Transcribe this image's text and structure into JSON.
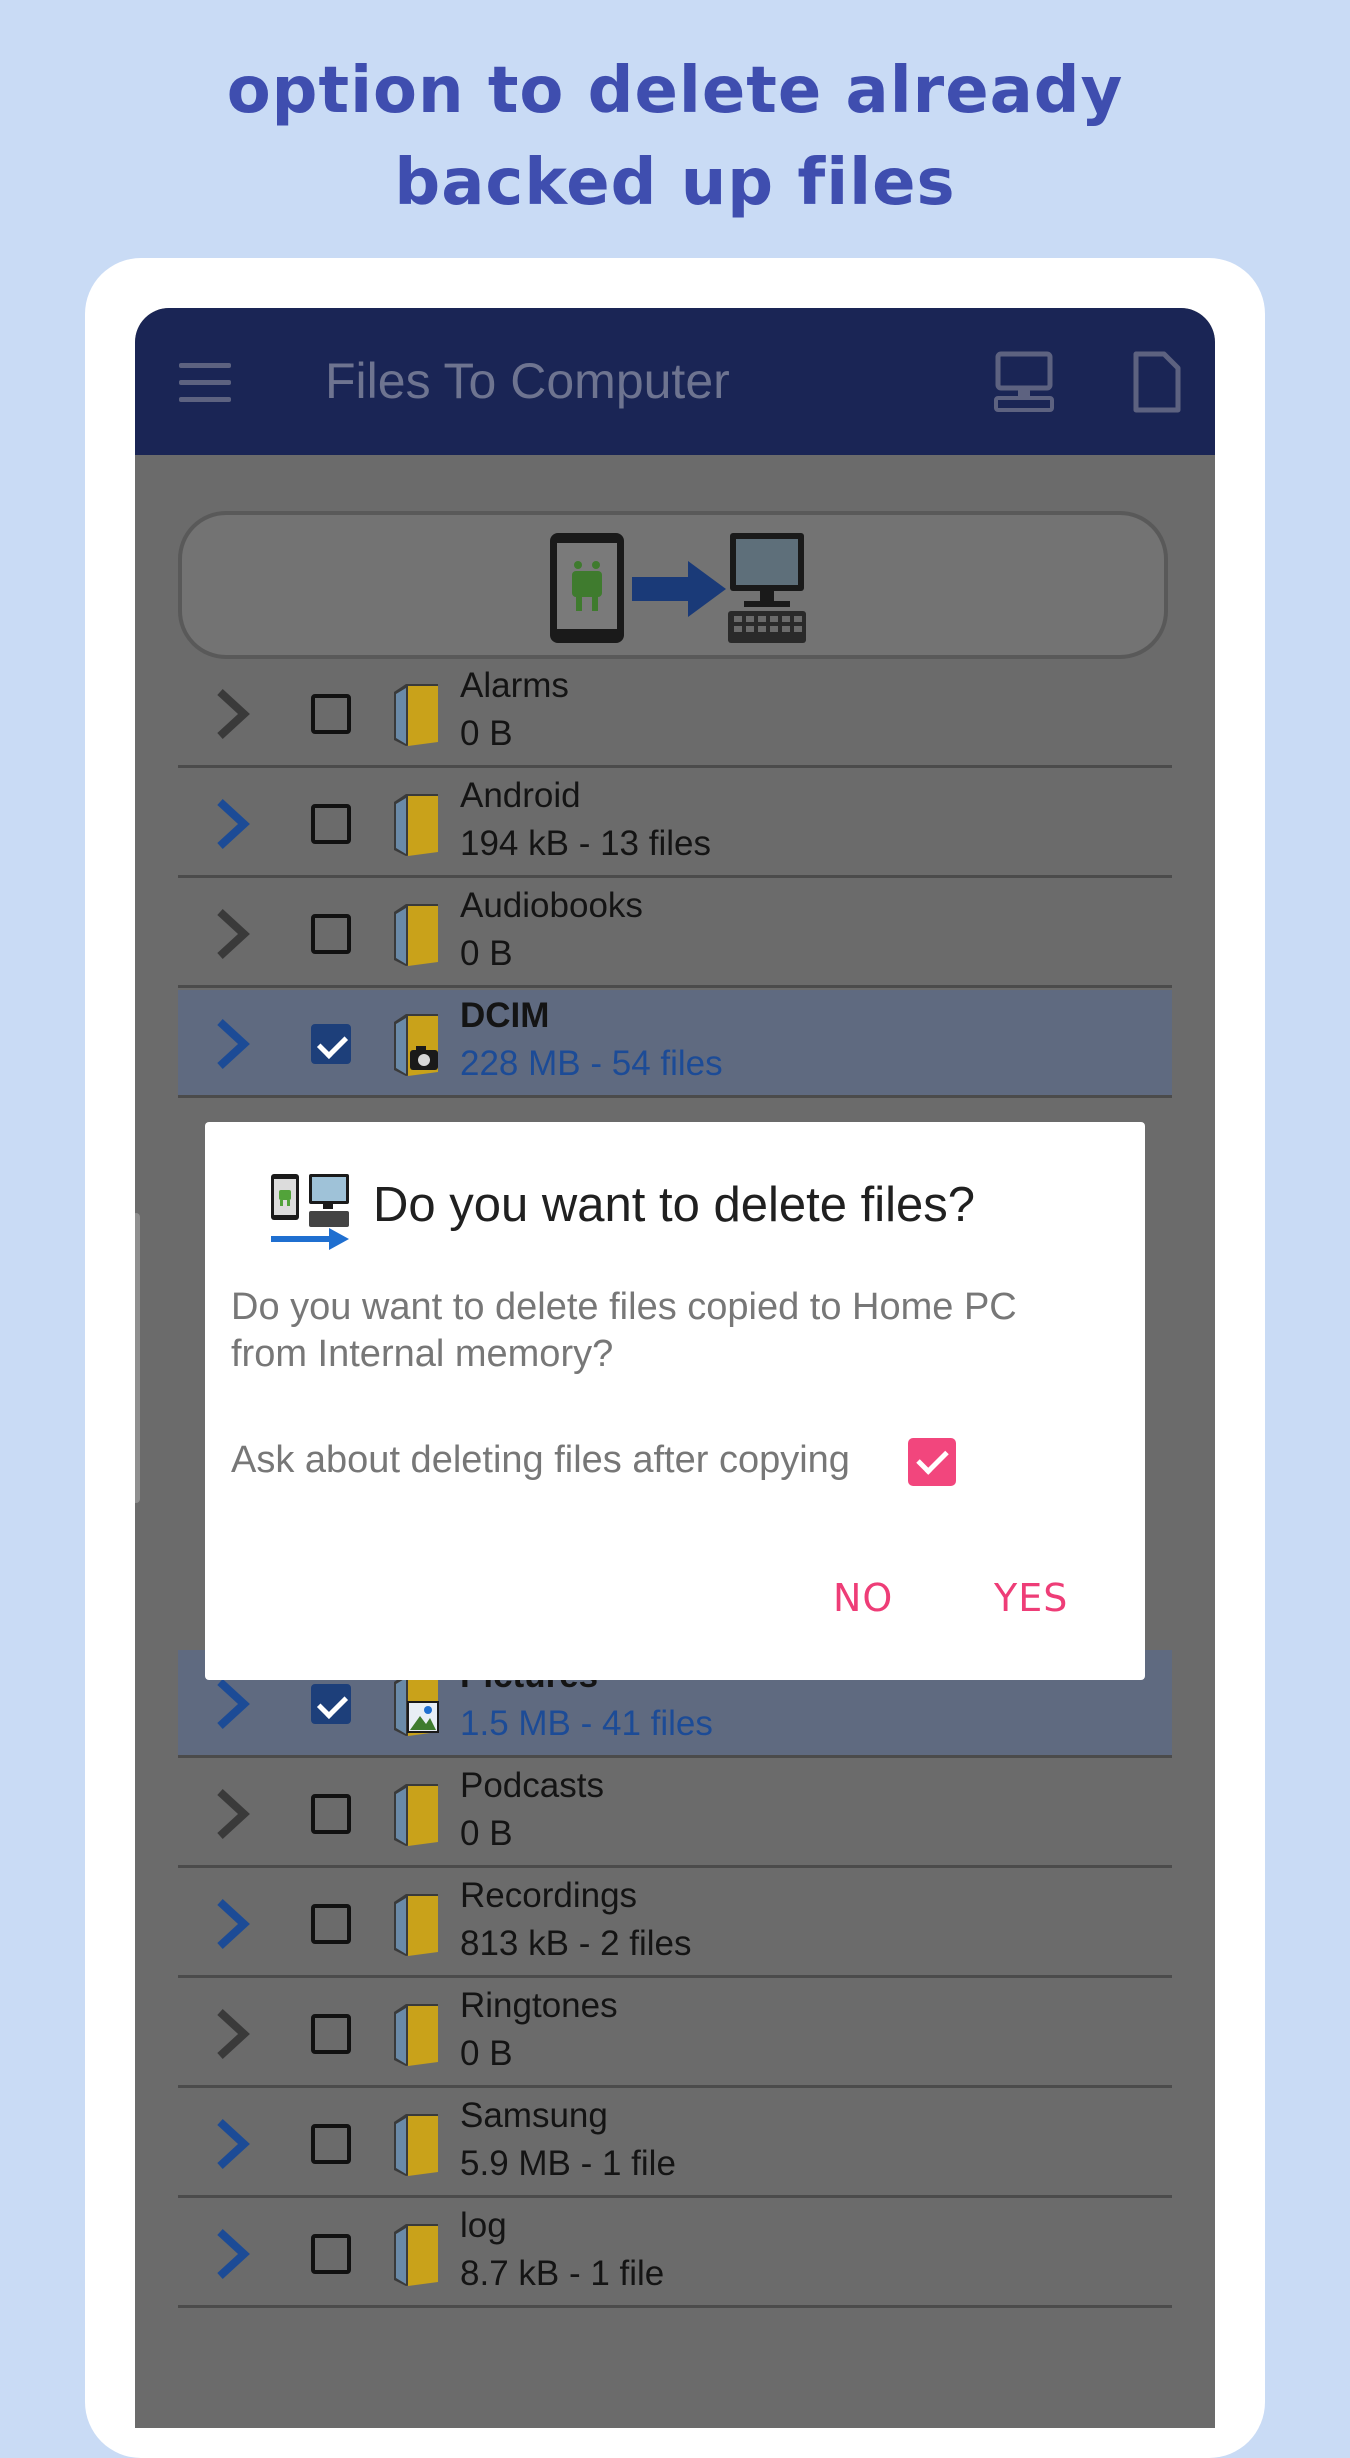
{
  "promo": {
    "headline_line1": "option to delete already",
    "headline_line2": "backed up files"
  },
  "appbar": {
    "title": "Files To Computer",
    "menu_icon": "hamburger-menu-icon",
    "actions": [
      "computer-icon",
      "document-icon"
    ]
  },
  "transfer_button": {
    "icon": "phone-to-computer-icon"
  },
  "folders": [
    {
      "name": "Alarms",
      "meta": "0 B",
      "checked": false,
      "folder_icon": "folder-icon"
    },
    {
      "name": "Android",
      "meta": "194 kB - 13 files",
      "checked": false,
      "folder_icon": "folder-icon"
    },
    {
      "name": "Audiobooks",
      "meta": "0 B",
      "checked": false,
      "folder_icon": "folder-icon"
    },
    {
      "name": "DCIM",
      "meta": "228 MB - 54 files",
      "checked": true,
      "folder_icon": "camera-folder-icon"
    },
    {
      "name": "Pictures",
      "meta": "1.5 MB - 41 files",
      "checked": true,
      "folder_icon": "pictures-folder-icon"
    },
    {
      "name": "Podcasts",
      "meta": "0 B",
      "checked": false,
      "folder_icon": "folder-icon"
    },
    {
      "name": "Recordings",
      "meta": "813 kB - 2 files",
      "checked": false,
      "folder_icon": "folder-icon"
    },
    {
      "name": "Ringtones",
      "meta": "0 B",
      "checked": false,
      "folder_icon": "folder-icon"
    },
    {
      "name": "Samsung",
      "meta": "5.9 MB - 1 file",
      "checked": false,
      "folder_icon": "folder-icon"
    },
    {
      "name": "log",
      "meta": "8.7 kB - 1 file",
      "checked": false,
      "folder_icon": "folder-icon"
    }
  ],
  "dialog": {
    "title": "Do you want to delete files?",
    "message": "Do you want to delete files copied to Home PC from Internal memory?",
    "ask_label": "Ask about deleting files after copying",
    "ask_checked": true,
    "no_label": "NO",
    "yes_label": "YES"
  },
  "colors": {
    "accent": "#ee3d77",
    "appbar": "#1a2555",
    "headline": "#3f4eaf"
  }
}
